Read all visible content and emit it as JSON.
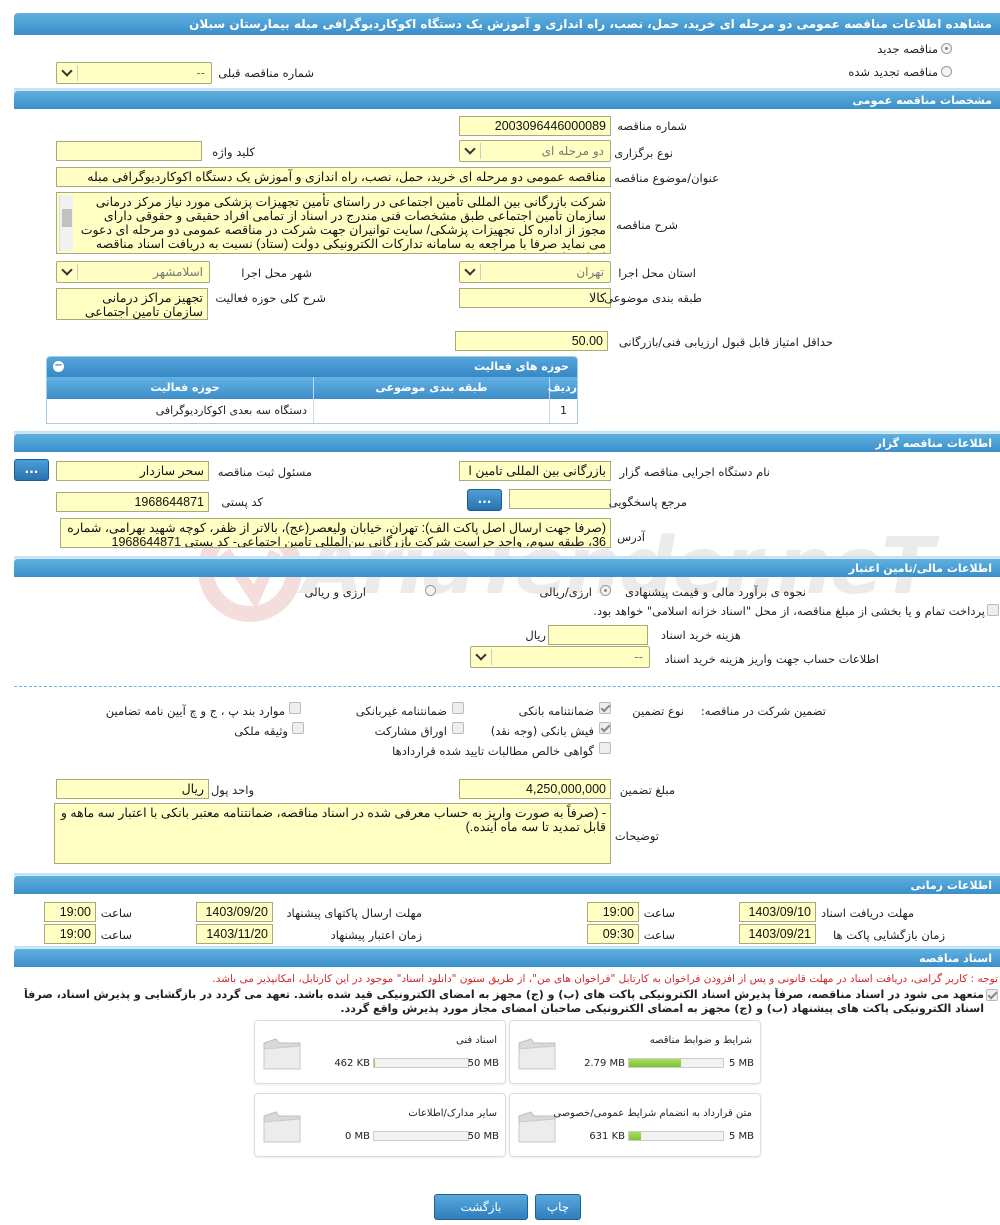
{
  "page_title": "مشاهده اطلاعات مناقصه عمومی دو مرحله ای خرید، حمل، نصب، راه اندازی و آموزش یک دستگاه اکوکاردیوگرافی مبله بیمارستان سبلان",
  "watermark": "AriaTender.neT",
  "tender_type": {
    "new_label": "مناقصه جدید",
    "renewed_label": "مناقصه تجدید شده",
    "prev_number_label": "شماره مناقصه قبلی",
    "prev_number_value": "--"
  },
  "general": {
    "section_title": "مشخصات مناقصه عمومی",
    "number_label": "شماره مناقصه",
    "number_value": "2003096446000089",
    "holding_type_label": "نوع برگزاری",
    "holding_type_value": "دو مرحله ای",
    "keyword_label": "کلید واژه",
    "keyword_value": "",
    "subject_label": "عنوان/موضوع مناقصه",
    "subject_value": "مناقصه عمومی دو مرحله ای خرید، حمل، نصب، راه اندازی و آموزش یک دستگاه اکوکاردیوگرافی مبله",
    "description_label": "شرح مناقصه",
    "description_value": "شرکت بازرگانی بین المللی تأمین اجتماعی در راستای تأمین تجهیزات پزشکی مورد نیاز مرکز درمانی سازمان تأمین اجتماعی طبق مشخصات فنی مندرج در اسناد از تمامی افراد حقیقی و حقوقی دارای مجوز از اداره کل تجهیزات پزشکی/ سایت توانیران جهت شرکت در مناقصه عمومی دو مرحله ای دعوت می نماید صرفا با مراجعه به سامانه تدارکات الکترونیکی دولت (ستاد) نسبت به دریافت اسناد مناقصه اقدام و اسناد",
    "province_label": "استان محل اجرا",
    "province_value": "تهران",
    "city_label": "شهر محل اجرا",
    "city_value": "اسلامشهر",
    "category_label": "طبقه بندی موضوعی",
    "category_value": "کالا",
    "activity_desc_label": "شرح کلی حوزه فعالیت",
    "activity_desc_value": "تجهیز مراکز درمانی سازمان تامین اجتماعی",
    "min_score_label": "حداقل امتیاز قابل قبول ارزیابی فنی/بازرگانی",
    "min_score_value": "50.00"
  },
  "activity_grid": {
    "title": "حوزه های فعالیت",
    "toggle": "−",
    "headers": [
      "ردیف",
      "طبقه بندی موضوعی",
      "حوزه فعالیت"
    ],
    "rows": [
      {
        "idx": "1",
        "category": "",
        "field": "دستگاه سه بعدی اکوکاردیوگرافی"
      }
    ]
  },
  "organizer": {
    "section_title": "اطلاعات مناقصه گزار",
    "org_name_label": "نام دستگاه اجرایی مناقصه گزار",
    "org_name_value": "بازرگانی بین المللی تامین ا",
    "registrar_label": "مسئول ثبت مناقصه",
    "registrar_value": "سحر سازدار",
    "dots": "...",
    "responder_label": "مرجع پاسخگویی",
    "responder_value": "",
    "postal_label": "کد پستی",
    "postal_value": "1968644871",
    "address_label": "آدرس",
    "address_value": "(صرفا جهت ارسال اصل پاکت الف): تهران، خیابان ولیعصر(عج)، بالاتر از ظفر، کوچه شهید بهرامی، شماره 36، طبقه سوم، واحد حراست شرکت بازرگانی بین‌المللی تامین اجتماعی- کد پستی 1968644871"
  },
  "finance": {
    "section_title": "اطلاعات مالی/تامین اعتبار",
    "estimate_label": "نحوه ی برآورد مالی و قیمت پیشنهادی",
    "opt_currency": "ارزی/ریالی",
    "opt_currency_fx": "ارزی و ریالی",
    "treasury_note": "پرداخت تمام و یا بخشی از مبلغ مناقصه، از محل \"اسناد خزانه اسلامی\" خواهد بود.",
    "doc_fee_label": "هزینه خرید اسناد",
    "doc_fee_value": "",
    "doc_fee_unit": "ریال",
    "account_label": "اطلاعات حساب جهت واریز هزینه خرید اسناد",
    "account_value": "--"
  },
  "guarantee": {
    "title": "تضمین شرکت در مناقصه:",
    "type_label": "نوع تضمین",
    "opts": {
      "bank_guarantee": "ضمانتنامه بانکی",
      "nonbank_guarantee": "ضمانتنامه غیربانکی",
      "items_b_j_ch": "موارد بند پ ، ج و چ آیین نامه تضامین",
      "bank_receipt": "فیش بانکی (وجه نقد)",
      "partnership_bonds": "اوراق مشارکت",
      "property_bond": "وثیقه ملکی",
      "certified_claims": "گواهی خالص مطالبات تایید شده قراردادها"
    },
    "amount_label": "مبلغ تضمین",
    "amount_value": "4,250,000,000",
    "currency_label": "واحد پول",
    "currency_value": "ریال",
    "notes_label": "توضیحات",
    "notes_value": "- (صرفاً به صورت واریز به حساب معرفی شده در اسناد مناقصه، ضمانتنامه معتبر بانکی با اعتبار سه ماهه و قابل تمدید تا سه ماه آینده.)"
  },
  "timing": {
    "section_title": "اطلاعات زمانی",
    "receive_deadline_label": "مهلت دریافت اسناد",
    "receive_deadline_date": "1403/09/10",
    "receive_deadline_time": "19:00",
    "send_deadline_label": "مهلت ارسال پاکتهای پیشنهاد",
    "send_deadline_date": "1403/09/20",
    "send_deadline_time": "19:00",
    "opening_label": "زمان بازگشایی پاکت ها",
    "opening_date": "1403/09/21",
    "opening_time": "09:30",
    "validity_label": "زمان اعتبار پیشنهاد",
    "validity_date": "1403/11/20",
    "validity_time": "19:00",
    "time_label": "ساعت"
  },
  "documents": {
    "section_title": "اسناد مناقصه",
    "notice_red": "توجه : کاربر گرامی، دریافت اسناد در مهلت قانونی و پس از افزودن فراخوان به کارتابل \"فراخوان های من\"، از طریق ستون \"دانلود اسناد\" موجود در این کارتابل، امکانپذیر می باشد.",
    "commit_text": "متعهد می شود در اسناد مناقصه، صرفاً پذیرش اسناد الکترونیکی پاکت های (ب) و (ج) مجهز به امضای الکترونیکی قید شده باشد. تعهد می گردد در بازگشایی و پذیرش اسناد، صرفاً اسناد الکترونیکی پاکت های پیشنهاد (ب) و (ج) مجهز به امضای الکترونیکی صاحبان امضای مجاز مورد پذیرش واقع گردد.",
    "files": [
      {
        "name": "شرایط و ضوابط مناقصه",
        "size": "2.79 MB",
        "max": "5 MB",
        "fraction": 0.558
      },
      {
        "name": "اسناد فنی",
        "size": "462 KB",
        "max": "50 MB",
        "fraction": 0.009
      },
      {
        "name": "متن قرارداد به انضمام شرایط عمومی/خصوصی",
        "size": "631 KB",
        "max": "5 MB",
        "fraction": 0.123
      },
      {
        "name": "سایر مدارک/اطلاعات",
        "size": "0 MB",
        "max": "50 MB",
        "fraction": 0.0
      }
    ]
  },
  "buttons": {
    "print": "چاپ",
    "back": "بازگشت"
  }
}
